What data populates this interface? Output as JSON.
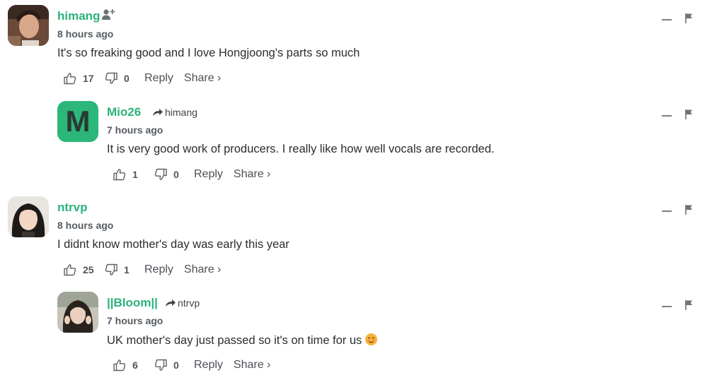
{
  "comments": [
    {
      "username": "himang",
      "time": "8 hours ago",
      "text": "It's so freaking good and I love Hongjoong's parts so much",
      "likes": "17",
      "dislikes": "0",
      "reply_label": "Reply",
      "share_label": "Share ›"
    },
    {
      "username": "Mio26",
      "avatar_letter": "M",
      "reply_to": "himang",
      "time": "7 hours ago",
      "text": "It is very good work of producers. I really like how well vocals are recorded.",
      "likes": "1",
      "dislikes": "0",
      "reply_label": "Reply",
      "share_label": "Share ›"
    },
    {
      "username": "ntrvp",
      "time": "8 hours ago",
      "text": "I didnt know mother's day was early this year",
      "likes": "25",
      "dislikes": "1",
      "reply_label": "Reply",
      "share_label": "Share ›"
    },
    {
      "username": "||Bloom||",
      "reply_to": "ntrvp",
      "time": "7 hours ago",
      "text": "UK mother's day just passed so it's on time for us",
      "likes": "6",
      "dislikes": "0",
      "reply_label": "Reply",
      "share_label": "Share ›"
    }
  ],
  "colors": {
    "username": "#2ab27b",
    "letter_avatar_bg": "#2bb67a",
    "text": "#2a2e2e",
    "muted": "#555b60"
  },
  "icons": [
    "follow-user-icon",
    "reply-arrow-icon",
    "thumbs-up-icon",
    "thumbs-down-icon",
    "collapse-icon",
    "flag-icon",
    "smiling-face-emoji"
  ]
}
